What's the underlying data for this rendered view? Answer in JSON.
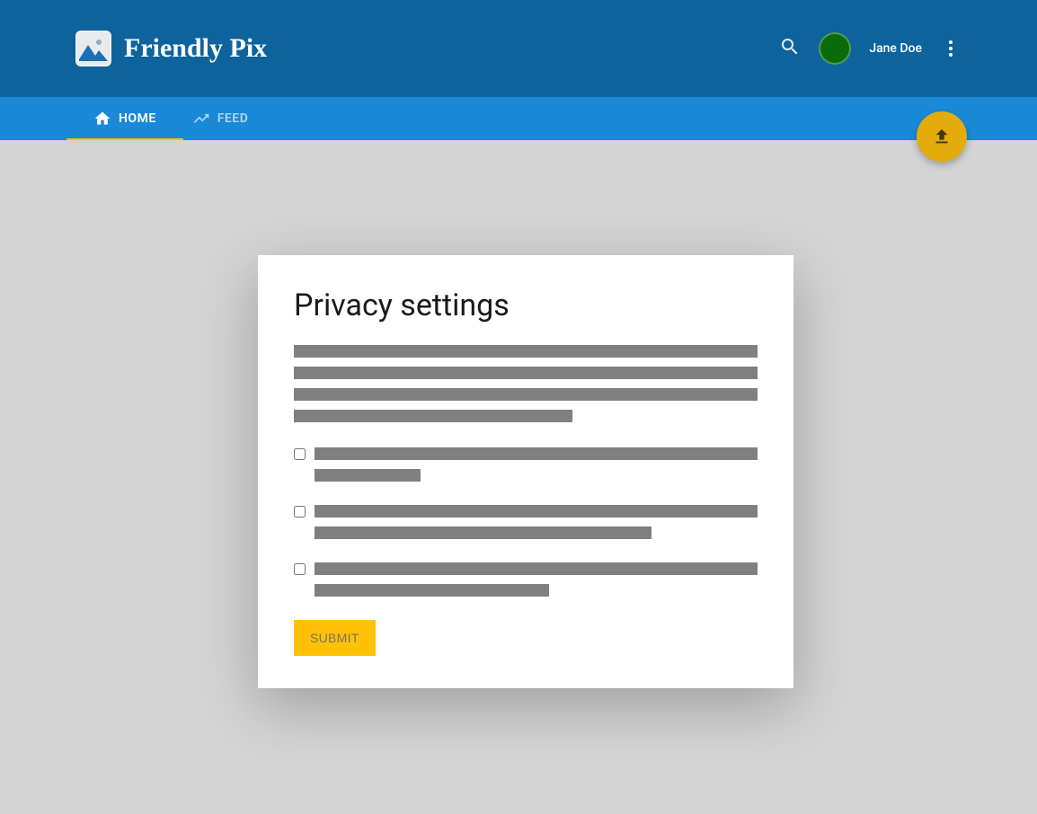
{
  "header": {
    "app_name": "Friendly Pix",
    "username": "Jane Doe"
  },
  "tabs": {
    "home": "HOME",
    "feed": "FEED",
    "active": "home"
  },
  "card": {
    "title": "Privacy settings",
    "submit_label": "SUBMIT",
    "checkboxes": [
      {
        "checked": false
      },
      {
        "checked": false
      },
      {
        "checked": false
      }
    ]
  },
  "colors": {
    "header_bg": "#0e639c",
    "tabs_bg": "#1989d8",
    "accent": "#ffc107",
    "fab": "#e3ac0c",
    "avatar": "#0a6b0a"
  }
}
